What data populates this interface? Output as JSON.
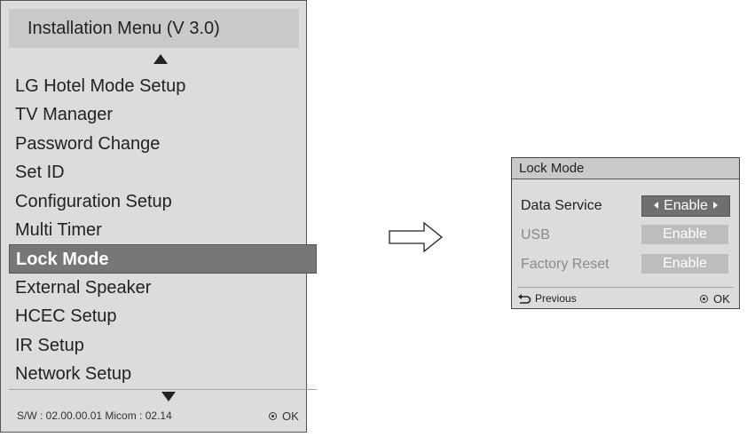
{
  "installation_menu": {
    "title": "Installation Menu (V 3.0)",
    "items": [
      {
        "label": "LG Hotel Mode Setup"
      },
      {
        "label": "TV Manager"
      },
      {
        "label": "Password Change"
      },
      {
        "label": "Set ID"
      },
      {
        "label": "Configuration Setup"
      },
      {
        "label": "Multi Timer"
      },
      {
        "label": "Lock Mode",
        "selected": true
      },
      {
        "label": "External Speaker"
      },
      {
        "label": "HCEC Setup"
      },
      {
        "label": "IR Setup"
      },
      {
        "label": "Network Setup"
      }
    ],
    "footer_info": "S/W : 02.00.00.01 Micom : 02.14",
    "ok_label": "OK"
  },
  "lock_mode": {
    "title": "Lock Mode",
    "rows": [
      {
        "label": "Data Service",
        "value": "Enable",
        "state": "active"
      },
      {
        "label": "USB",
        "value": "Enable",
        "state": "disabled"
      },
      {
        "label": "Factory Reset",
        "value": "Enable",
        "state": "disabled"
      }
    ],
    "previous_label": "Previous",
    "ok_label": "OK"
  },
  "icons": {
    "scroll_up": "up-arrow-icon",
    "scroll_down": "down-arrow-icon",
    "transition": "right-arrow-icon",
    "back": "back-arrow-icon",
    "ok": "ok-button-icon"
  },
  "colors": {
    "panel_background": "#dcdcdc",
    "title_background": "#c9c9c9",
    "selection": "#777777",
    "active_value": "#6f6f6f",
    "inactive_value": "#bdbdbd"
  }
}
